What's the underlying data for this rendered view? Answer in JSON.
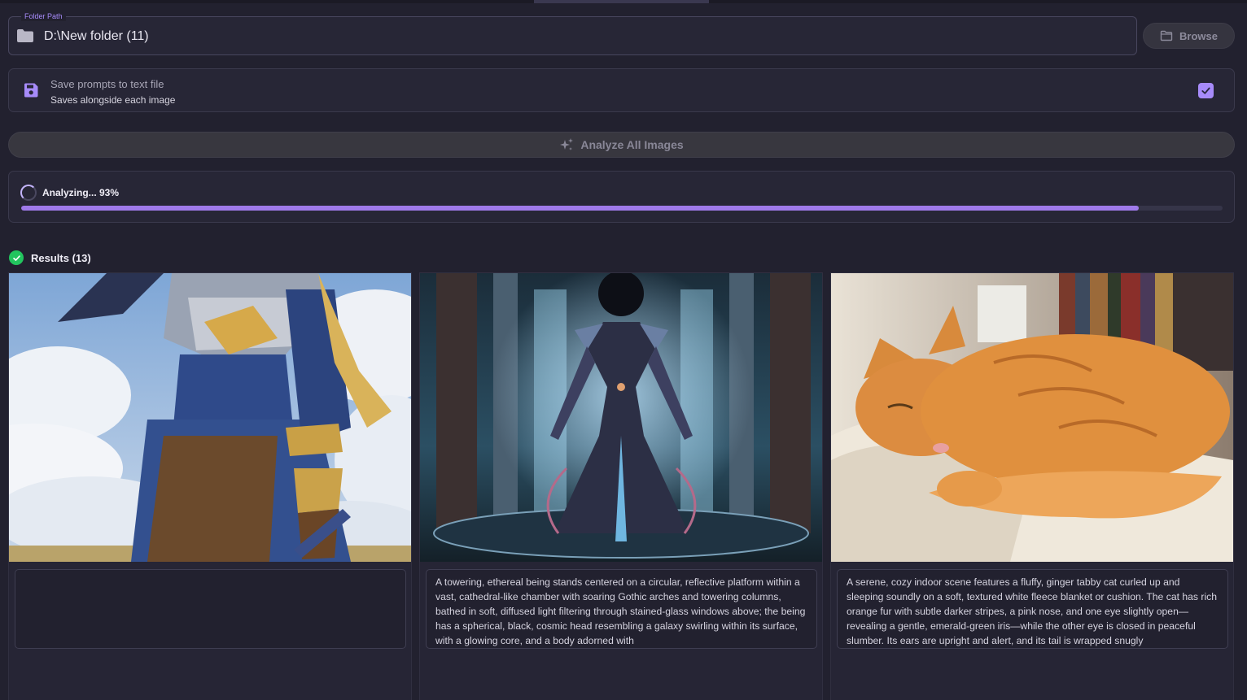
{
  "folder": {
    "legend": "Folder Path",
    "value": "D:\\New folder (11)",
    "icon": "folder-icon"
  },
  "browse": {
    "label": "Browse",
    "icon": "folder-outline-icon"
  },
  "save_option": {
    "title": "Save prompts to text file",
    "subtitle": "Saves alongside each image",
    "checked": true,
    "icon": "save-icon"
  },
  "analyze": {
    "label": "Analyze All Images",
    "icon": "sparkles-icon"
  },
  "progress": {
    "label": "Analyzing... 93%",
    "percent": 93
  },
  "results": {
    "title": "Results (13)",
    "items": [
      {
        "image": "armored-knight-with-braid",
        "prompt": ""
      },
      {
        "image": "cosmic-being-in-cathedral",
        "prompt": "A towering, ethereal being stands centered on a circular, reflective platform within a vast, cathedral-like chamber with soaring Gothic arches and towering columns, bathed in soft, diffused light filtering through stained-glass windows above; the being has a spherical, black, cosmic head resembling a galaxy swirling within its surface, with a glowing core, and a body adorned with"
      },
      {
        "image": "sleeping-ginger-cat",
        "prompt": "A serene, cozy indoor scene features a fluffy, ginger tabby cat curled up and sleeping soundly on a soft, textured white fleece blanket or cushion. The cat has rich orange fur with subtle darker stripes, a pink nose, and one eye slightly open—revealing a gentle, emerald-green iris—while the other eye is closed in peaceful slumber. Its ears are upright and alert, and its tail is wrapped snugly"
      }
    ]
  },
  "colors": {
    "background": "#22212f",
    "accent": "#a78bfa",
    "progress": "#9f7aea",
    "success": "#22c55e"
  }
}
